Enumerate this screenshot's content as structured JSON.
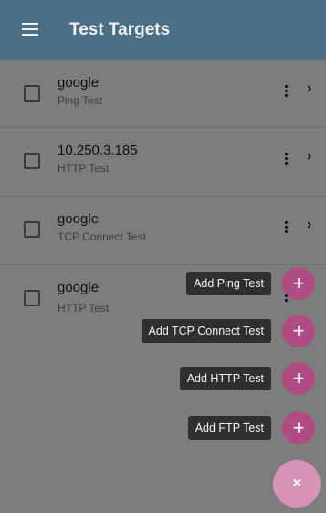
{
  "header": {
    "title": "Test Targets",
    "menu_icon": "hamburger-menu-icon"
  },
  "targets": [
    {
      "name": "google",
      "type": "Ping Test"
    },
    {
      "name": "10.250.3.185",
      "type": "HTTP Test"
    },
    {
      "name": "google",
      "type": "TCP Connect Test"
    },
    {
      "name": "google",
      "type": "HTTP Test"
    }
  ],
  "speed_dial": {
    "actions": [
      {
        "label": "Add Ping Test",
        "icon": "+"
      },
      {
        "label": "Add TCP Connect Test",
        "icon": "+"
      },
      {
        "label": "Add HTTP Test",
        "icon": "+"
      },
      {
        "label": "Add FTP Test",
        "icon": "+"
      }
    ],
    "close_icon": "×"
  },
  "colors": {
    "appbar": "#4b6f86",
    "scrim": "#7d7d7d",
    "fab_accent": "#b04b83",
    "main_fab": "#d793b6"
  }
}
